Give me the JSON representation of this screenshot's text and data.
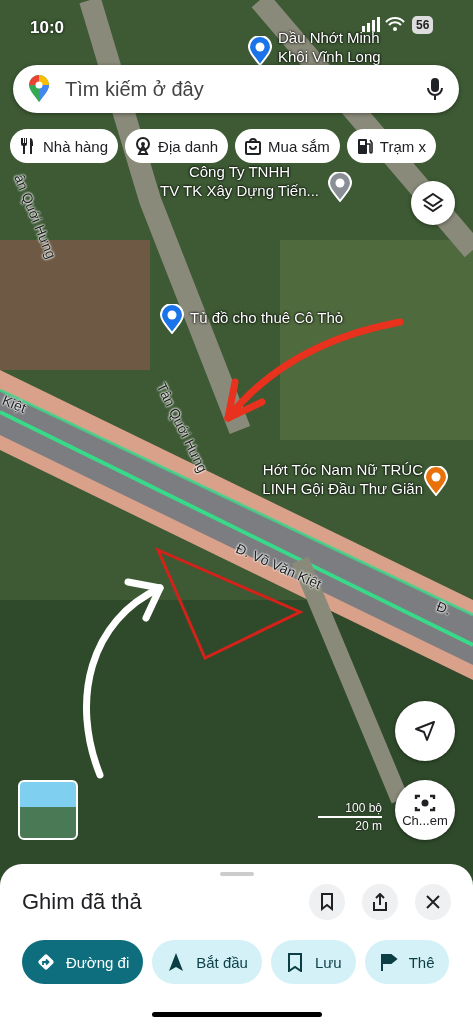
{
  "status_bar": {
    "time": "10:0",
    "battery": "56"
  },
  "search": {
    "placeholder": "Tìm kiếm ở đây"
  },
  "categories": [
    {
      "kind": "restaurant",
      "label": "Nhà hàng"
    },
    {
      "kind": "landmark",
      "label": "Địa danh"
    },
    {
      "kind": "shopping",
      "label": "Mua sắm"
    },
    {
      "kind": "fuel",
      "label": "Trạm x"
    }
  ],
  "map": {
    "places": [
      {
        "kind": "shopping",
        "lines": [
          "Dầu Nhớt Minh",
          "Khôi Vĩnh Long"
        ]
      },
      {
        "kind": "generic",
        "lines": [
          "Công Ty TNHH",
          "TV TK Xây Dựng Tiến..."
        ]
      },
      {
        "kind": "shopping",
        "lines": [
          "Tủ đồ cho thuê Cô Thỏ"
        ]
      },
      {
        "kind": "salon",
        "lines": [
          "Hớt Tóc Nam Nữ TRÚC",
          "LINH Gội Đầu Thư Giãn"
        ]
      }
    ],
    "roads": [
      "ân Quới Hưng",
      "Tân Quới Hưng",
      "Kiệt",
      "Đ. Võ Văn Kiệt",
      "Đ."
    ],
    "scale": {
      "imperial": "100 bộ",
      "metric": "20 m"
    },
    "camera_label": "Ch...em"
  },
  "sheet": {
    "title": "Ghim đã thả",
    "actions": [
      {
        "kind": "directions",
        "label": "Đường đi",
        "primary": true
      },
      {
        "kind": "start",
        "label": "Bắt đầu",
        "primary": false
      },
      {
        "kind": "save",
        "label": "Lưu",
        "primary": false
      },
      {
        "kind": "flag",
        "label": "Thê",
        "primary": false
      }
    ]
  }
}
